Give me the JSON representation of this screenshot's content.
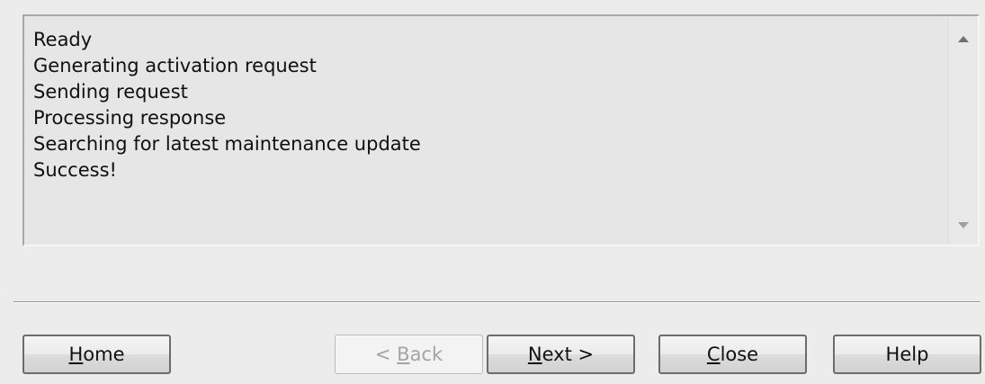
{
  "log": {
    "lines": [
      "Ready",
      "Generating activation request",
      "Sending request",
      "Processing response",
      "Searching for latest maintenance update",
      "Success!"
    ]
  },
  "buttons": {
    "home": {
      "mnemonic": "H",
      "rest": "ome"
    },
    "back": {
      "prefix": "< ",
      "mnemonic": "B",
      "rest": "ack",
      "disabled": true
    },
    "next": {
      "mnemonic": "N",
      "rest": "ext >"
    },
    "close": {
      "mnemonic": "C",
      "rest": "lose"
    },
    "help": {
      "label": "Help"
    }
  },
  "icons": {
    "scroll_up": "scroll-up-arrow-icon",
    "scroll_down": "scroll-down-arrow-icon"
  }
}
